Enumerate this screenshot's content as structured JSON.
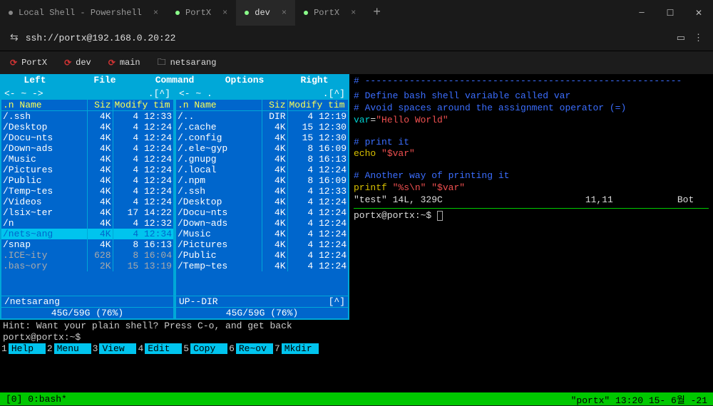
{
  "tabs": [
    {
      "label": "Local Shell - Powershell",
      "active": false
    },
    {
      "label": "PortX",
      "active": false
    },
    {
      "label": "dev",
      "active": true
    },
    {
      "label": "PortX",
      "active": false
    }
  ],
  "address": "ssh://portx@192.168.0.20:22",
  "quick": [
    {
      "label": "PortX",
      "icon": "reload"
    },
    {
      "label": "dev",
      "icon": "reload"
    },
    {
      "label": "main",
      "icon": "reload"
    },
    {
      "label": "netsarang",
      "icon": "folder"
    }
  ],
  "fm": {
    "menu": [
      "Left",
      "File",
      "Command",
      "Options",
      "Right"
    ],
    "headers": {
      "name": ".n Name",
      "size": "Siz",
      "mod": "Modify tim"
    },
    "left": {
      "rows": [
        {
          "n": "/.ssh",
          "s": "4K",
          "m": "4 12:33"
        },
        {
          "n": "/Desktop",
          "s": "4K",
          "m": "4 12:24"
        },
        {
          "n": "/Docu~nts",
          "s": "4K",
          "m": "4 12:24"
        },
        {
          "n": "/Down~ads",
          "s": "4K",
          "m": "4 12:24"
        },
        {
          "n": "/Music",
          "s": "4K",
          "m": "4 12:24"
        },
        {
          "n": "/Pictures",
          "s": "4K",
          "m": "4 12:24"
        },
        {
          "n": "/Public",
          "s": "4K",
          "m": "4 12:24"
        },
        {
          "n": "/Temp~tes",
          "s": "4K",
          "m": "4 12:24"
        },
        {
          "n": "/Videos",
          "s": "4K",
          "m": "4 12:24"
        },
        {
          "n": "/lsix~ter",
          "s": "4K",
          "m": "17 14:22"
        },
        {
          "n": "/n",
          "s": "4K",
          "m": "4 12:32"
        },
        {
          "n": "/nets~ang",
          "s": "4K",
          "m": "4 12:34",
          "sel": true
        },
        {
          "n": "/snap",
          "s": "4K",
          "m": "8 16:13"
        },
        {
          "n": " .ICE~ity",
          "s": "628",
          "m": "8 16:04",
          "gray": true
        },
        {
          "n": " .bas~ory",
          "s": "2K",
          "m": "15 13:19",
          "gray": true
        }
      ],
      "path": "/netsarang",
      "disk": "45G/59G (76%)",
      "arrow": "[^]"
    },
    "right": {
      "rows": [
        {
          "n": "/..",
          "s": "DIR",
          "m": "4 12:19"
        },
        {
          "n": "/.cache",
          "s": "4K",
          "m": "15 12:30"
        },
        {
          "n": "/.config",
          "s": "4K",
          "m": "15 12:30"
        },
        {
          "n": "/.ele~gyp",
          "s": "4K",
          "m": "8 16:09"
        },
        {
          "n": "/.gnupg",
          "s": "4K",
          "m": "8 16:13"
        },
        {
          "n": "/.local",
          "s": "4K",
          "m": "4 12:24"
        },
        {
          "n": "/.npm",
          "s": "4K",
          "m": "8 16:09"
        },
        {
          "n": "/.ssh",
          "s": "4K",
          "m": "4 12:33"
        },
        {
          "n": "/Desktop",
          "s": "4K",
          "m": "4 12:24"
        },
        {
          "n": "/Docu~nts",
          "s": "4K",
          "m": "4 12:24"
        },
        {
          "n": "/Down~ads",
          "s": "4K",
          "m": "4 12:24"
        },
        {
          "n": "/Music",
          "s": "4K",
          "m": "4 12:24"
        },
        {
          "n": "/Pictures",
          "s": "4K",
          "m": "4 12:24"
        },
        {
          "n": "/Public",
          "s": "4K",
          "m": "4 12:24"
        },
        {
          "n": "/Temp~tes",
          "s": "4K",
          "m": "4 12:24"
        }
      ],
      "path": "UP--DIR",
      "disk": "45G/59G (76%)",
      "arrow": "[^]"
    },
    "hint": "Hint: Want your plain shell? Press C-o, and get back",
    "prompt": "portx@portx:~$",
    "arrow_tilde_l": "<- ~ ->",
    "arrow_tilde_r": "<- ~ .",
    "fkeys": [
      {
        "n": "1",
        "l": "Help"
      },
      {
        "n": "2",
        "l": "Menu"
      },
      {
        "n": "3",
        "l": "View"
      },
      {
        "n": "4",
        "l": "Edit"
      },
      {
        "n": "5",
        "l": "Copy"
      },
      {
        "n": "6",
        "l": "Re~ov"
      },
      {
        "n": "7",
        "l": "Mkdir"
      }
    ]
  },
  "term": {
    "dashes": "# ---------------------------------------------------------",
    "c1": "# Define bash shell variable called var",
    "c2": "# Avoid spaces around the assignment operator (=)",
    "var_kw": "var",
    "eq": "=",
    "var_val": "\"Hello World\"",
    "c3": "# print it",
    "echo_kw": "echo",
    "echo_arg": "\"$var\"",
    "c4": "# Another way of printing it",
    "printf_kw": "printf",
    "printf_a1": "\"%s\\n\"",
    "printf_a2": "\"$var\"",
    "status_l": "\"test\" 14L, 329C",
    "status_m": "11,11",
    "status_r": "Bot",
    "prompt": "portx@portx:~$ "
  },
  "bottom": {
    "left": "[0] 0:bash*",
    "right": "\"portx\" 13:20 15- 6월 -21"
  }
}
